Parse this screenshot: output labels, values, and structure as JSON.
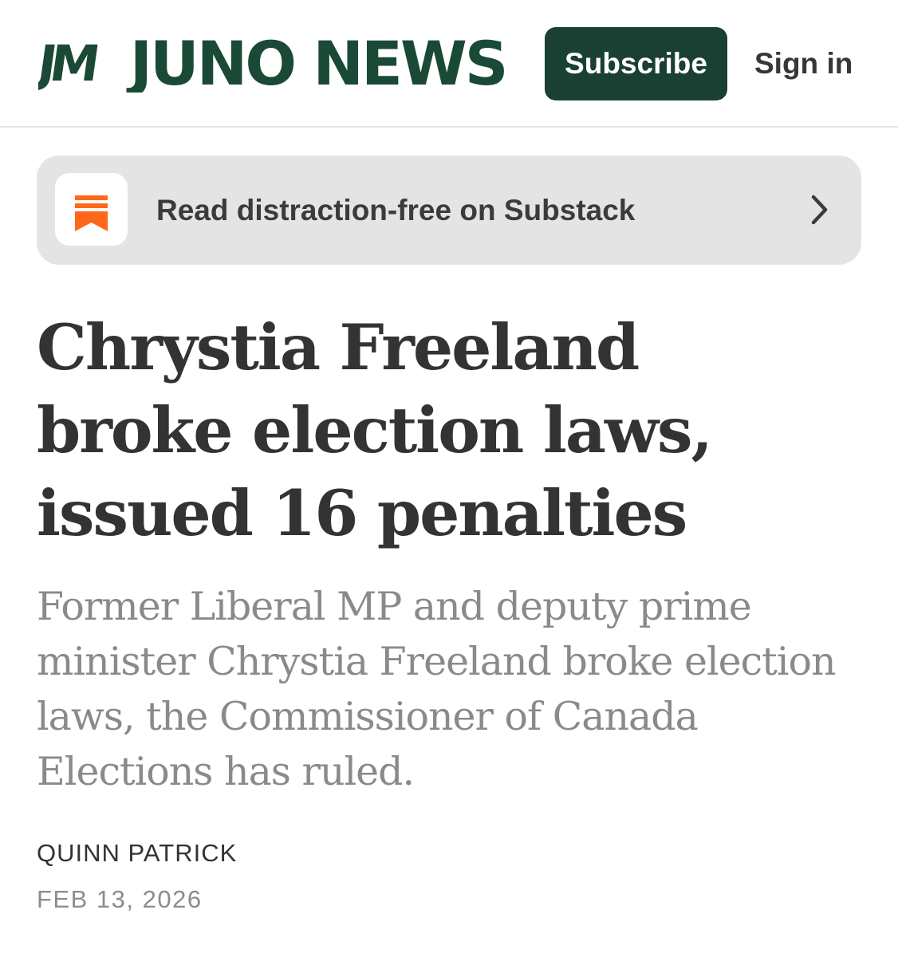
{
  "header": {
    "logo_mark": "JM",
    "logo_text": "JUNO NEWS",
    "subscribe_label": "Subscribe",
    "signin_label": "Sign in",
    "brand_color": "#1a4033"
  },
  "banner": {
    "text": "Read distraction-free on Substack",
    "icon": "substack-icon",
    "icon_color": "#ff6719",
    "chevron": "chevron-right-icon"
  },
  "article": {
    "title_lines": [
      "Chrystia Freeland",
      "broke election laws,",
      "issued 16 penalties"
    ],
    "subtitle_lines": [
      "Former Liberal MP and deputy prime",
      "minister Chrystia Freeland broke election",
      "laws, the Commissioner of Canada",
      "Elections has ruled."
    ],
    "author": "QUINN PATRICK",
    "date": "FEB 13, 2026"
  }
}
